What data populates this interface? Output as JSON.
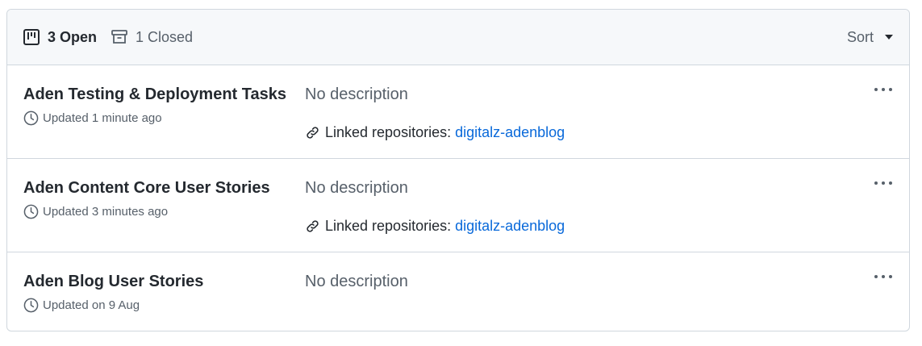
{
  "header": {
    "open_label": "3 Open",
    "closed_label": "1 Closed",
    "sort_label": "Sort"
  },
  "projects": [
    {
      "title": "Aden Testing & Deployment Tasks",
      "updated": "Updated 1 minute ago",
      "description": "No description",
      "linked_label": "Linked repositories:",
      "linked_repo": "digitalz-adenblog"
    },
    {
      "title": "Aden Content Core User Stories",
      "updated": "Updated 3 minutes ago",
      "description": "No description",
      "linked_label": "Linked repositories:",
      "linked_repo": "digitalz-adenblog"
    },
    {
      "title": "Aden Blog User Stories",
      "updated": "Updated on 9 Aug",
      "description": "No description"
    }
  ],
  "icons": {
    "open": "project-icon",
    "closed": "archive-icon",
    "sort": "caret-down-icon",
    "updated": "clock-icon",
    "linked": "link-icon",
    "more": "kebab-horizontal-icon"
  },
  "colors": {
    "link": "#0969da",
    "muted": "#57606a",
    "text": "#24292f",
    "header_bg": "#f6f8fa",
    "border": "#d0d7de"
  }
}
